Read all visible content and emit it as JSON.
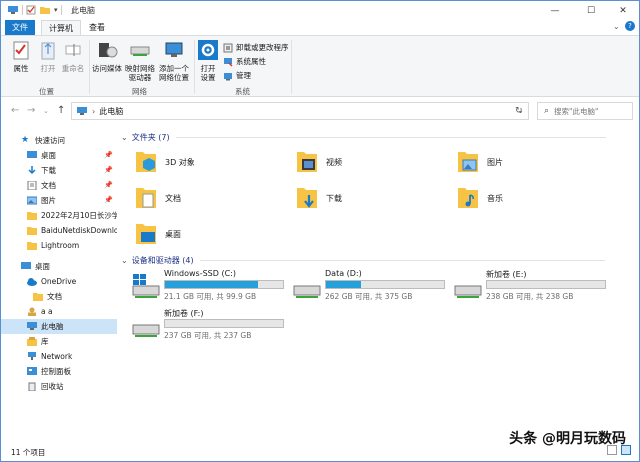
{
  "titlebar": {
    "title": "此电脑",
    "minimize": "—",
    "maximize": "☐",
    "close": "✕"
  },
  "ribbon_tabs": [
    {
      "label": "文件"
    },
    {
      "label": "计算机"
    },
    {
      "label": "查看"
    }
  ],
  "ribbon": {
    "group_location": "位置",
    "group_network": "网络",
    "group_system": "系统",
    "properties": "属性",
    "open": "打开",
    "rename": "重命名",
    "access_media_1": "访问媒体",
    "access_media_2": "",
    "map_drive_1": "映射网络",
    "map_drive_2": "驱动器",
    "add_location_1": "添加一个",
    "add_location_2": "网络位置",
    "open_settings_1": "打开",
    "open_settings_2": "设置",
    "uninstall": "卸载或更改程序",
    "system_props": "系统属性",
    "manage": "管理"
  },
  "address": {
    "path": "此电脑",
    "search_placeholder": "搜索\"此电脑\""
  },
  "nav": {
    "quick_access": "快速访问",
    "items": [
      {
        "label": "桌面",
        "pinned": true
      },
      {
        "label": "下载",
        "pinned": true
      },
      {
        "label": "文档",
        "pinned": true
      },
      {
        "label": "图片",
        "pinned": true
      },
      {
        "label": "2022年2月10日长沙学"
      },
      {
        "label": "BaiduNetdiskDownlo"
      },
      {
        "label": "Lightroom"
      }
    ],
    "desktop": "桌面",
    "onedrive": "OneDrive",
    "onedrive_docs": "文档",
    "user": "a a",
    "this_pc": "此电脑",
    "library": "库",
    "network": "Network",
    "control_panel": "控制面板",
    "recycle": "回收站"
  },
  "folders_header": "文件夹 (7)",
  "folders": [
    {
      "name": "3D 对象"
    },
    {
      "name": "视频"
    },
    {
      "name": "图片"
    },
    {
      "name": "文档"
    },
    {
      "name": "下载"
    },
    {
      "name": "音乐"
    },
    {
      "name": "桌面"
    }
  ],
  "drives_header": "设备和驱动器 (4)",
  "drives": [
    {
      "name": "Windows-SSD (C:)",
      "size": "21.1 GB 可用, 共 99.9 GB",
      "used_fraction": 0.79
    },
    {
      "name": "Data (D:)",
      "size": "262 GB 可用, 共 375 GB",
      "used_fraction": 0.3
    },
    {
      "name": "新加卷 (E:)",
      "size": "238 GB 可用, 共 238 GB",
      "used_fraction": 0.0
    },
    {
      "name": "新加卷 (F:)",
      "size": "237 GB 可用, 共 237 GB",
      "used_fraction": 0.0
    }
  ],
  "status": {
    "count": "11 个项目"
  },
  "watermark": "头条 @明月玩数码",
  "colors": {
    "accent": "#1979ca",
    "folder": "#f6c344",
    "drive_bar": "#26a0da",
    "selection": "#cce4f7"
  }
}
